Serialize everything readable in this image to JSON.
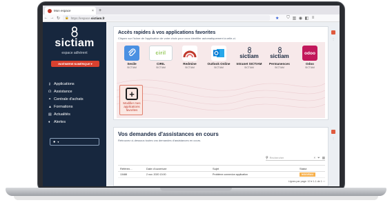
{
  "browser": {
    "tab_title": "Mon espace",
    "close_glyph": "×",
    "new_tab_glyph": "+",
    "url_prefix": "https://espace.",
    "url_domain": "sictiam.fr"
  },
  "sidebar": {
    "brand": "sictiam",
    "subtitle": "espace adhérent",
    "role_button": "INGÉNIERIE NUMÉRIQUE",
    "role_caret": "▾",
    "items": [
      {
        "label": "Applications",
        "icon": "key-icon"
      },
      {
        "label": "Assistance",
        "icon": "headset-icon"
      },
      {
        "label": "Centrale d'achats",
        "icon": "handshake-icon"
      },
      {
        "label": "Formations",
        "icon": "graduation-cap-icon"
      },
      {
        "label": "Actualités",
        "icon": "newspaper-icon"
      },
      {
        "label": "Alertes",
        "icon": "bell-icon"
      }
    ],
    "user_caret": "▾"
  },
  "quick_access": {
    "title": "Accès rapides à vos applications favorites",
    "subtitle": "Cliquez sur l'icône de l'application de votre choix pour vous identifier automatiquement à celle-ci.",
    "apps": [
      {
        "name": "Sesile",
        "org": "SICTIAM",
        "icon": "paperclip-icon",
        "color": "#4a90e2"
      },
      {
        "name": "CIRIL",
        "org": "SICTIAM",
        "icon": "ciril-logo",
        "color": "#8bc34a"
      },
      {
        "name": "Redmine",
        "org": "SICTIAM",
        "icon": "redmine-logo",
        "color": "#c0392b"
      },
      {
        "name": "Outlook Online",
        "org": "SICTIAM",
        "icon": "outlook-logo",
        "color": "#0078d4"
      },
      {
        "name": "Intranet SICTIAM",
        "org": "SICTIAM",
        "icon": "sictiam-logo",
        "color": "#17273e"
      },
      {
        "name": "Permanences",
        "org": "SICTIAM",
        "icon": "sictiam-logo",
        "color": "#17273e"
      },
      {
        "name": "Odoo",
        "org": "SICTIAM",
        "icon": "odoo-logo",
        "color": "#c2185b"
      }
    ],
    "ciril_text": "ciril",
    "sictiam_word": "sictiam",
    "odoo_text": "odoo",
    "modify_favorites": "Modifier mes applications favorites",
    "plus_glyph": "+"
  },
  "assistance": {
    "title": "Vos demandes d'assistances en cours",
    "subtitle": "Retrouvez ci-dessous toutes vos demandes d'assistances en cours.",
    "search_placeholder": "Rechercher",
    "columns": [
      "Référen...",
      "Date d'ouverture",
      "Sujet",
      "Statut"
    ],
    "rows": [
      {
        "reference": "13488",
        "date": "2 nov. 2020 13:00",
        "subject": "Problème connexion application",
        "status": "NOUVEAU"
      }
    ],
    "pager": "Lignes par page: 10 ▾  1-1 de 1  ‹  ›"
  },
  "colors": {
    "sidebar_bg": "#17273e",
    "accent": "#d9412f",
    "status_new": "#f7b04c"
  }
}
